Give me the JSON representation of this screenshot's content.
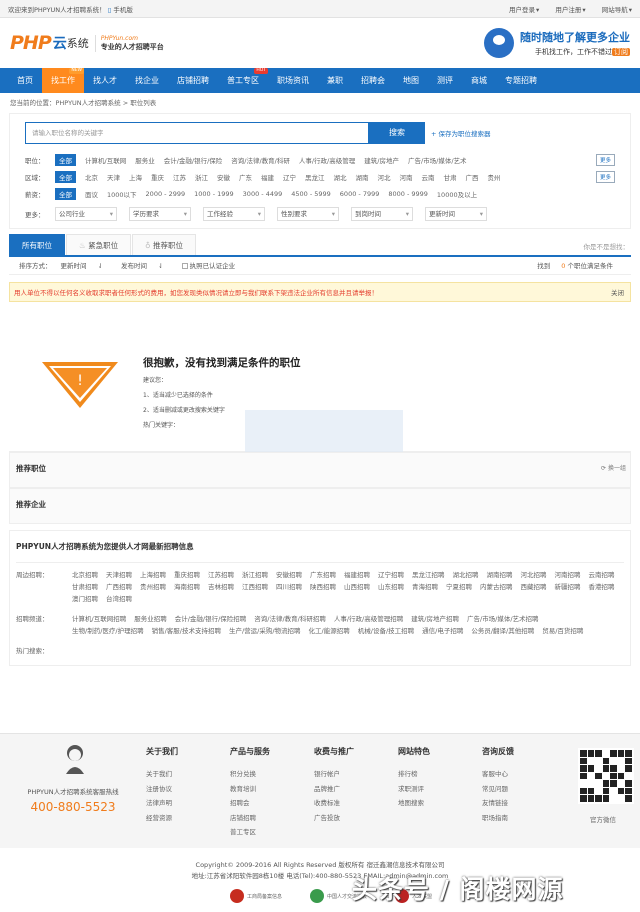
{
  "topbar": {
    "welcome": "欢迎来到PHPYUN人才招聘系统！",
    "mobile": "手机版",
    "login": "用户登录",
    "register": "用户注册",
    "nav": "网站导航"
  },
  "header": {
    "logo_php": "PHP",
    "logo_cloud": "云",
    "logo_sys": "系统",
    "logo_domain": "PHPYun.com",
    "logo_tag": "专业的人才招聘平台",
    "slogan1": "随时随地了解更多企业",
    "slogan2": "手机找工作，工作不错过",
    "slogan2_tag": "订阅"
  },
  "nav": [
    {
      "label": "首页"
    },
    {
      "label": "找工作",
      "active": true,
      "badge": "NEW"
    },
    {
      "label": "找人才"
    },
    {
      "label": "找企业"
    },
    {
      "label": "店铺招聘"
    },
    {
      "label": "普工专区",
      "badge": "HOT"
    },
    {
      "label": "职场资讯"
    },
    {
      "label": "兼职"
    },
    {
      "label": "招聘会"
    },
    {
      "label": "地图"
    },
    {
      "label": "测评"
    },
    {
      "label": "商城"
    },
    {
      "label": "专题招聘"
    }
  ],
  "breadcrumb": "您当前的位置：PHPYUN人才招聘系统 > 职位列表",
  "search": {
    "placeholder": "请输入职位名称的关键字",
    "button": "搜索",
    "save": "+ 保存为职位搜索器"
  },
  "filters": {
    "job": {
      "label": "职位：",
      "options": [
        "全部",
        "计算机/互联网",
        "服务业",
        "会计/金融/银行/保险",
        "咨询/法律/教育/科研",
        "人事/行政/高级管理",
        "建筑/房地产",
        "广告/市场/媒体/艺术"
      ],
      "more": "更多"
    },
    "area": {
      "label": "区域：",
      "options": [
        "全部",
        "北京",
        "天津",
        "上海",
        "重庆",
        "江苏",
        "浙江",
        "安徽",
        "广东",
        "福建",
        "辽宁",
        "黑龙江",
        "湖北",
        "湖南",
        "河北",
        "河南",
        "云南",
        "甘肃",
        "广西",
        "贵州"
      ],
      "more": "更多"
    },
    "salary": {
      "label": "薪资：",
      "options": [
        "全部",
        "面议",
        "1000以下",
        "2000 - 2999",
        "1000 - 1999",
        "3000 - 4499",
        "4500 - 5999",
        "6000 - 7999",
        "8000 - 9999",
        "10000及以上"
      ]
    },
    "more": {
      "label": "更多：",
      "selects": [
        "公司行业",
        "学历要求",
        "工作经验",
        "性别要求",
        "到岗时间",
        "更新时间"
      ]
    }
  },
  "tabs": {
    "all": "所有职位",
    "urgent": "紧急职位",
    "recommend": "推荐职位",
    "hint": "你是不是想找："
  },
  "sort": {
    "label": "排序方式：",
    "update": "更新时间",
    "publish": "发布时间",
    "cert": "执照已认证企业",
    "found_pre": "找到",
    "found_num": "0",
    "found_post": "个职位满足条件"
  },
  "notice": {
    "text": "用人单位不得以任何名义收取求职者任何形式的费用，如您发现类似情况请立即与我们联系下架违法企业所有信息并且请举报！",
    "close": "关闭"
  },
  "empty": {
    "title": "很抱歉，没有找到满足条件的职位",
    "suggest": "建议您：",
    "tip1": "1、适当减少已选择的条件",
    "tip2": "2、适当删减或更改搜索关键字",
    "hot": "热门关键字："
  },
  "recommend_jobs": {
    "title": "推荐职位",
    "change": "换一组"
  },
  "recommend_company": {
    "title": "推荐企业"
  },
  "links": {
    "title": "PHPYUN人才招聘系统为您提供人才网最新招聘信息",
    "area_label": "周边招聘：",
    "area": [
      "北京招聘",
      "天津招聘",
      "上海招聘",
      "重庆招聘",
      "江苏招聘",
      "浙江招聘",
      "安徽招聘",
      "广东招聘",
      "福建招聘",
      "辽宁招聘",
      "黑龙江招聘",
      "湖北招聘",
      "湖南招聘",
      "河北招聘",
      "河南招聘",
      "云南招聘",
      "甘肃招聘",
      "广西招聘",
      "贵州招聘",
      "海南招聘",
      "吉林招聘",
      "江西招聘",
      "四川招聘",
      "陕西招聘",
      "山西招聘",
      "山东招聘",
      "青海招聘",
      "宁夏招聘",
      "内蒙古招聘",
      "西藏招聘",
      "新疆招聘",
      "香港招聘",
      "澳门招聘",
      "台湾招聘"
    ],
    "job_label": "招聘频道：",
    "job": [
      "计算机/互联网招聘",
      "服务业招聘",
      "会计/金融/银行/保险招聘",
      "咨询/法律/教育/科研招聘",
      "人事/行政/高级管理招聘",
      "建筑/房地产招聘",
      "广告/市场/媒体/艺术招聘",
      "生物/制药/医疗/护理招聘",
      "销售/客服/技术支持招聘",
      "生产/营运/采购/物流招聘",
      "化工/能源招聘",
      "机械/设备/技工招聘",
      "通信/电子招聘",
      "公务员/翻译/其他招聘",
      "贸易/百货招聘"
    ],
    "hot_label": "热门搜索："
  },
  "footer": {
    "hotline": "PHPYUN人才招聘系统客服热线",
    "phone": "400-880-5523",
    "cols": [
      {
        "title": "关于我们",
        "items": [
          "关于我们",
          "注册协议",
          "法律声明",
          "经营资源"
        ]
      },
      {
        "title": "产品与服务",
        "items": [
          "积分兑换",
          "教育培训",
          "招聘会",
          "店铺招聘",
          "普工专区"
        ]
      },
      {
        "title": "收费与推广",
        "items": [
          "银行帐户",
          "品牌推广",
          "收费标准",
          "广告投放"
        ]
      },
      {
        "title": "网站特色",
        "items": [
          "排行榜",
          "求职测评",
          "地图搜索"
        ]
      },
      {
        "title": "咨询反馈",
        "items": [
          "客服中心",
          "常见问题",
          "友情链接",
          "职场指南"
        ]
      }
    ],
    "qr_label": "官方微信",
    "copyright": "Copyright© 2009-2016 All Rights Reserved 版权所有 宿迁鑫潮信息技术有限公司",
    "address": "地址:江苏省沭阳软件园8栋10楼 电话(Tel):400-880-5523 EMAIL:admin@admin.com",
    "badges": [
      "工商局备案信息",
      "中国人才交流协会",
      "人才联盟"
    ]
  },
  "watermark": "头条号 / 阁楼网源",
  "colors": {
    "primary": "#1a6fc0",
    "accent": "#ff8a1e",
    "warning": "#e43c2d"
  }
}
